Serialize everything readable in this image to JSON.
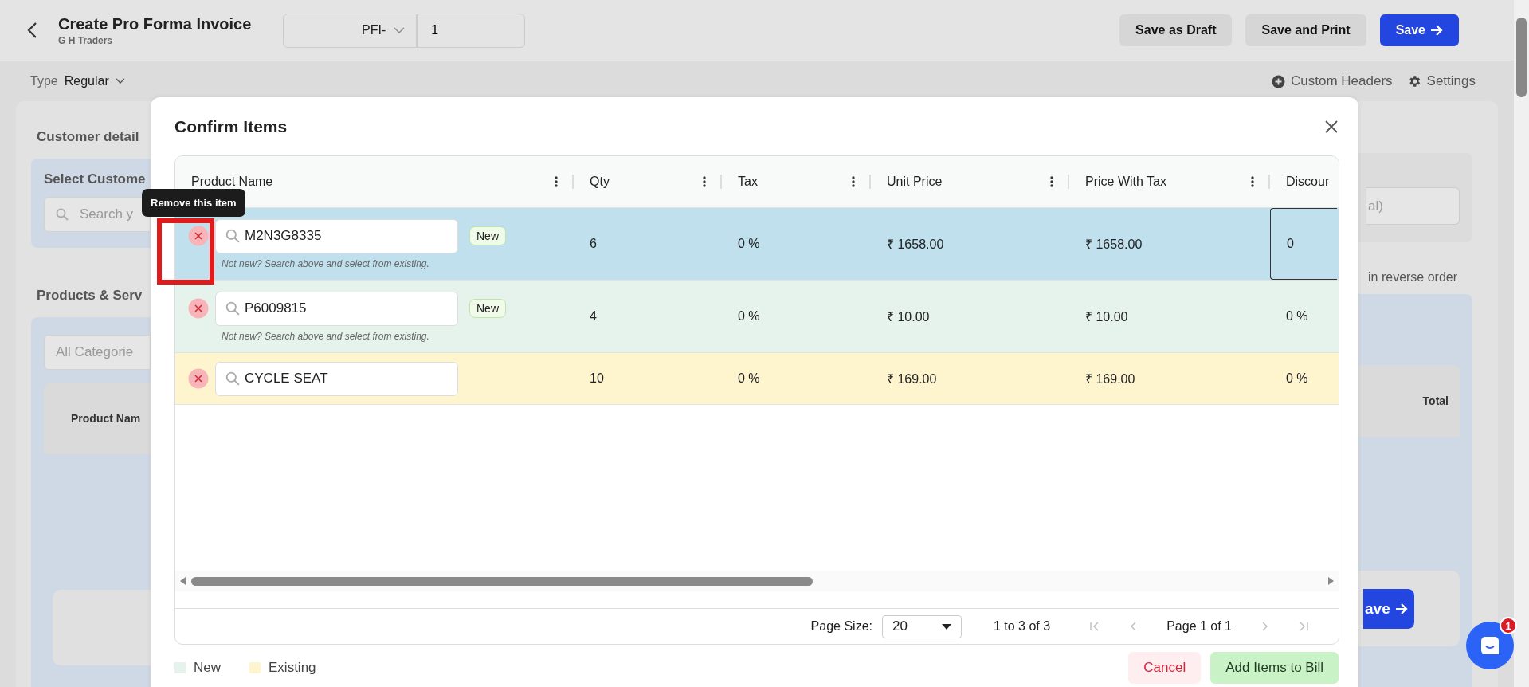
{
  "header": {
    "title": "Create Pro Forma Invoice",
    "subtitle": "G H Traders",
    "prefix": "PFI-",
    "number": "1",
    "buttons": [
      {
        "label": "Save as Draft",
        "kind": "secondary"
      },
      {
        "label": "Save and Print",
        "kind": "secondary"
      },
      {
        "label": "Save",
        "kind": "primary"
      }
    ]
  },
  "toolbar": {
    "type_label": "Type",
    "type_value": "Regular",
    "links": [
      {
        "label": "Custom Headers",
        "kind": "add"
      },
      {
        "label": "Settings",
        "kind": "gear"
      }
    ]
  },
  "background": {
    "left": {
      "customer_heading": "Customer detail",
      "select_label": "Select Custome",
      "search_placeholder": "Search y",
      "products_heading": "Products & Serv",
      "category": "All Categorie",
      "column": "Product Nam"
    },
    "right": {
      "note_placeholder": "al)",
      "reverse": "in reverse order",
      "column": "Total",
      "save": "ave"
    }
  },
  "dialog": {
    "title": "Confirm Items",
    "columns": [
      {
        "label": "Product Name"
      },
      {
        "label": "Qty"
      },
      {
        "label": "Tax"
      },
      {
        "label": "Unit Price"
      },
      {
        "label": "Price With Tax"
      },
      {
        "label": "Discour"
      }
    ],
    "rows": [
      {
        "product": "M2N3G8335",
        "kind": "new",
        "selected": true,
        "badge": "New",
        "hint": "Not new? Search above and select from existing.",
        "qty": "6",
        "tax": "0 %",
        "unit_price": "₹ 1658.00",
        "price_with_tax": "₹ 1658.00",
        "discount": "0",
        "editing": true
      },
      {
        "product": "P6009815",
        "kind": "new",
        "selected": false,
        "badge": "New",
        "hint": "Not new? Search above and select from existing.",
        "qty": "4",
        "tax": "0 %",
        "unit_price": "₹ 10.00",
        "price_with_tax": "₹ 10.00",
        "discount": "0 %",
        "editing": false
      },
      {
        "product": "CYCLE SEAT",
        "kind": "existing",
        "selected": false,
        "qty": "10",
        "tax": "0 %",
        "unit_price": "₹ 169.00",
        "price_with_tax": "₹ 169.00",
        "discount": "0 %",
        "editing": false
      }
    ],
    "pagination": {
      "page_size_label": "Page Size:",
      "page_size": "20",
      "range": "1 to 3 of 3",
      "page": "Page 1 of 1"
    },
    "legend": [
      {
        "label": "New",
        "color": "#e6f3ec"
      },
      {
        "label": "Existing",
        "color": "#fef5cf"
      }
    ],
    "buttons": [
      {
        "label": "Cancel",
        "kind": "cancel"
      },
      {
        "label": "Add Items to Bill",
        "kind": "confirm"
      }
    ]
  },
  "tooltip": "Remove this item",
  "annotation_frame": true,
  "chat": {
    "badge": "1"
  }
}
